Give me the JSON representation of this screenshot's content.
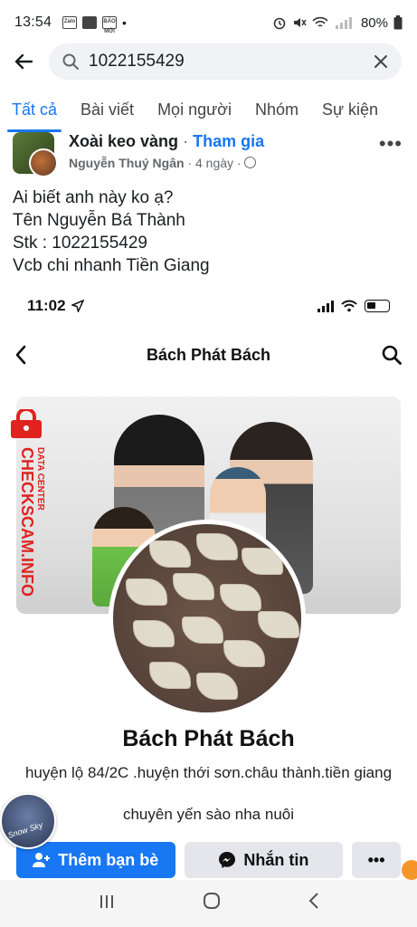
{
  "status_bar": {
    "time": "13:54",
    "notifications": [
      "Zalo",
      "BÁO MỚI"
    ],
    "battery": "80%"
  },
  "search": {
    "query": "1022155429"
  },
  "tabs": [
    "Tất cả",
    "Bài viết",
    "Mọi người",
    "Nhóm",
    "Sự kiện"
  ],
  "post": {
    "group_name": "Xoài keo vàng",
    "separator": "·",
    "join_label": "Tham gia",
    "author": "Nguyễn Thuý Ngân",
    "age": "· 4 ngày ·",
    "lines": [
      "Ai biết anh này ko ạ?",
      "Tên Nguyễn Bá Thành",
      "Stk : 1022155429",
      "Vcb chi nhanh Tiền Giang"
    ]
  },
  "screenshot": {
    "time": "11:02",
    "profile_title": "Bách Phát Bách",
    "profile_name": "Bách Phát Bách",
    "bio_line1": "huyện lộ 84/2C .huyện thới sơn.châu thành.tiền giang",
    "bio_line2": "chuyên yến sào nha nuôi",
    "add_friend_label": "Thêm bạn bè",
    "message_label": "Nhắn tin",
    "more_label": "•••"
  },
  "watermark": {
    "brand": "CHECKSCAM.INFO",
    "sub": "DATA CENTER"
  },
  "chat_head_caption": "Snow Sky",
  "icons": {
    "back": "arrow-left-icon",
    "search": "magnifier-icon",
    "clear": "close-icon",
    "more": "more-dots-icon",
    "globe": "globe-icon",
    "messenger": "messenger-icon",
    "add_friend": "add-friend-icon"
  },
  "colors": {
    "accent": "#1877f2",
    "watermark": "#e0231f"
  }
}
